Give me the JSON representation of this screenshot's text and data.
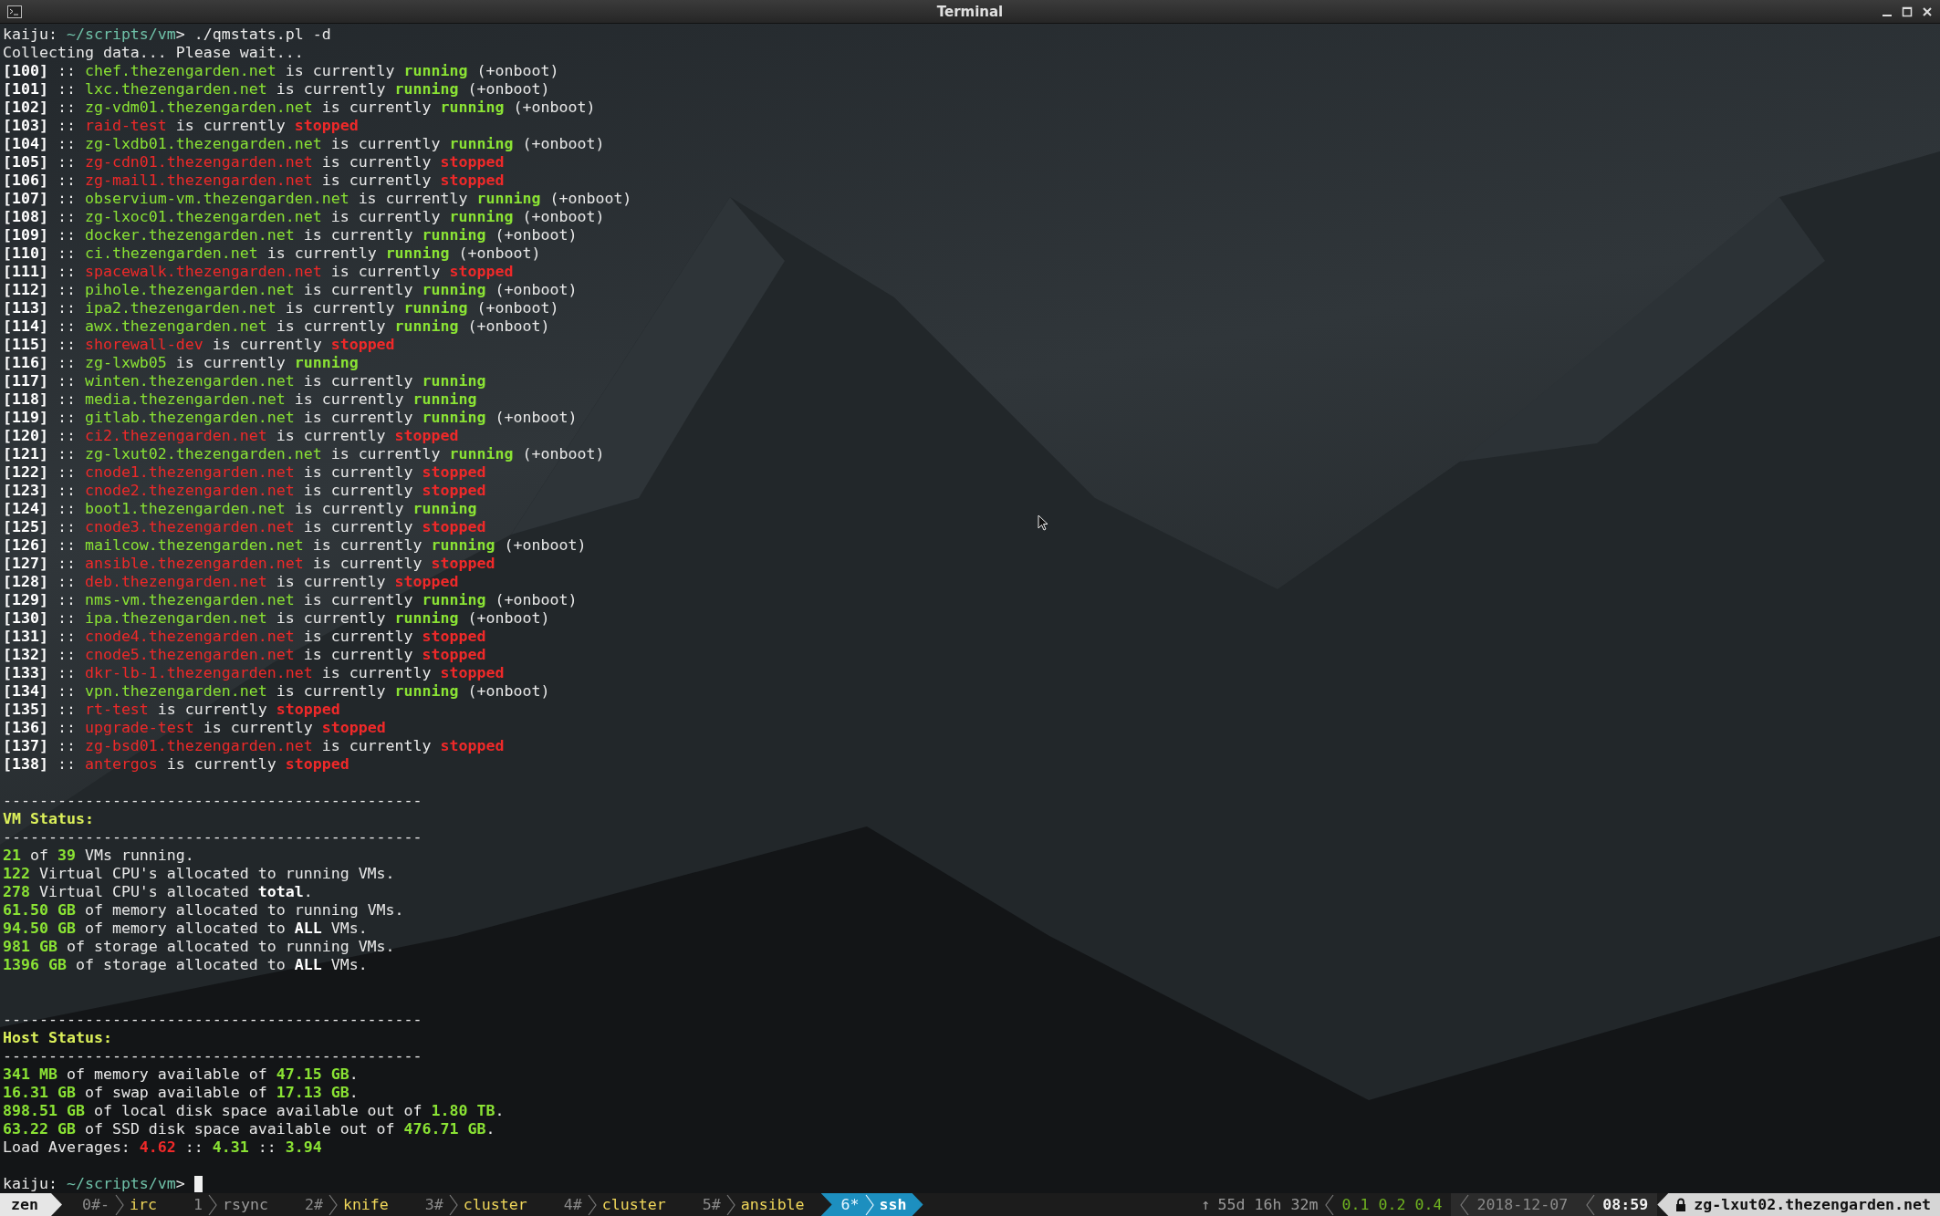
{
  "title_bar": {
    "title": "Terminal"
  },
  "terminal": {
    "command": {
      "user": "kaiju:",
      "path": "~/scripts/vm",
      "symbol": ">",
      "command": "./qmstats.pl -d"
    },
    "message": "Collecting data... Please wait...",
    "vms": [
      {
        "id": "[100]",
        "sep": "::",
        "host": "chef.thezengarden.net",
        "verb": "is currently",
        "state": "running",
        "kind": "running",
        "onboot": "(+onboot)"
      },
      {
        "id": "[101]",
        "sep": "::",
        "host": "lxc.thezengarden.net",
        "verb": "is currently",
        "state": "running",
        "kind": "running",
        "onboot": "(+onboot)"
      },
      {
        "id": "[102]",
        "sep": "::",
        "host": "zg-vdm01.thezengarden.net",
        "verb": "is currently",
        "state": "running",
        "kind": "running",
        "onboot": "(+onboot)"
      },
      {
        "id": "[103]",
        "sep": "::",
        "host": "raid-test",
        "verb": "is currently",
        "state": "stopped",
        "kind": "stopped"
      },
      {
        "id": "[104]",
        "sep": "::",
        "host": "zg-lxdb01.thezengarden.net",
        "verb": "is currently",
        "state": "running",
        "kind": "running",
        "onboot": "(+onboot)"
      },
      {
        "id": "[105]",
        "sep": "::",
        "host": "zg-cdn01.thezengarden.net",
        "verb": "is currently",
        "state": "stopped",
        "kind": "stopped"
      },
      {
        "id": "[106]",
        "sep": "::",
        "host": "zg-mail1.thezengarden.net",
        "verb": "is currently",
        "state": "stopped",
        "kind": "stopped"
      },
      {
        "id": "[107]",
        "sep": "::",
        "host": "observium-vm.thezengarden.net",
        "verb": "is currently",
        "state": "running",
        "kind": "running",
        "onboot": "(+onboot)"
      },
      {
        "id": "[108]",
        "sep": "::",
        "host": "zg-lxoc01.thezengarden.net",
        "verb": "is currently",
        "state": "running",
        "kind": "running",
        "onboot": "(+onboot)"
      },
      {
        "id": "[109]",
        "sep": "::",
        "host": "docker.thezengarden.net",
        "verb": "is currently",
        "state": "running",
        "kind": "running",
        "onboot": "(+onboot)"
      },
      {
        "id": "[110]",
        "sep": "::",
        "host": "ci.thezengarden.net",
        "verb": "is currently",
        "state": "running",
        "kind": "running",
        "onboot": "(+onboot)"
      },
      {
        "id": "[111]",
        "sep": "::",
        "host": "spacewalk.thezengarden.net",
        "verb": "is currently",
        "state": "stopped",
        "kind": "stopped"
      },
      {
        "id": "[112]",
        "sep": "::",
        "host": "pihole.thezengarden.net",
        "verb": "is currently",
        "state": "running",
        "kind": "running",
        "onboot": "(+onboot)"
      },
      {
        "id": "[113]",
        "sep": "::",
        "host": "ipa2.thezengarden.net",
        "verb": "is currently",
        "state": "running",
        "kind": "running",
        "onboot": "(+onboot)"
      },
      {
        "id": "[114]",
        "sep": "::",
        "host": "awx.thezengarden.net",
        "verb": "is currently",
        "state": "running",
        "kind": "running",
        "onboot": "(+onboot)"
      },
      {
        "id": "[115]",
        "sep": "::",
        "host": "shorewall-dev",
        "verb": "is currently",
        "state": "stopped",
        "kind": "stopped"
      },
      {
        "id": "[116]",
        "sep": "::",
        "host": "zg-lxwb05",
        "verb": "is currently",
        "state": "running",
        "kind": "running"
      },
      {
        "id": "[117]",
        "sep": "::",
        "host": "winten.thezengarden.net",
        "verb": "is currently",
        "state": "running",
        "kind": "running"
      },
      {
        "id": "[118]",
        "sep": "::",
        "host": "media.thezengarden.net",
        "verb": "is currently",
        "state": "running",
        "kind": "running"
      },
      {
        "id": "[119]",
        "sep": "::",
        "host": "gitlab.thezengarden.net",
        "verb": "is currently",
        "state": "running",
        "kind": "running",
        "onboot": "(+onboot)"
      },
      {
        "id": "[120]",
        "sep": "::",
        "host": "ci2.thezengarden.net",
        "verb": "is currently",
        "state": "stopped",
        "kind": "stopped"
      },
      {
        "id": "[121]",
        "sep": "::",
        "host": "zg-lxut02.thezengarden.net",
        "verb": "is currently",
        "state": "running",
        "kind": "running",
        "onboot": "(+onboot)"
      },
      {
        "id": "[122]",
        "sep": "::",
        "host": "cnode1.thezengarden.net",
        "verb": "is currently",
        "state": "stopped",
        "kind": "stopped"
      },
      {
        "id": "[123]",
        "sep": "::",
        "host": "cnode2.thezengarden.net",
        "verb": "is currently",
        "state": "stopped",
        "kind": "stopped"
      },
      {
        "id": "[124]",
        "sep": "::",
        "host": "boot1.thezengarden.net",
        "verb": "is currently",
        "state": "running",
        "kind": "running"
      },
      {
        "id": "[125]",
        "sep": "::",
        "host": "cnode3.thezengarden.net",
        "verb": "is currently",
        "state": "stopped",
        "kind": "stopped"
      },
      {
        "id": "[126]",
        "sep": "::",
        "host": "mailcow.thezengarden.net",
        "verb": "is currently",
        "state": "running",
        "kind": "running",
        "onboot": "(+onboot)"
      },
      {
        "id": "[127]",
        "sep": "::",
        "host": "ansible.thezengarden.net",
        "verb": "is currently",
        "state": "stopped",
        "kind": "stopped"
      },
      {
        "id": "[128]",
        "sep": "::",
        "host": "deb.thezengarden.net",
        "verb": "is currently",
        "state": "stopped",
        "kind": "stopped"
      },
      {
        "id": "[129]",
        "sep": "::",
        "host": "nms-vm.thezengarden.net",
        "verb": "is currently",
        "state": "running",
        "kind": "running",
        "onboot": "(+onboot)"
      },
      {
        "id": "[130]",
        "sep": "::",
        "host": "ipa.thezengarden.net",
        "verb": "is currently",
        "state": "running",
        "kind": "running",
        "onboot": "(+onboot)"
      },
      {
        "id": "[131]",
        "sep": "::",
        "host": "cnode4.thezengarden.net",
        "verb": "is currently",
        "state": "stopped",
        "kind": "stopped"
      },
      {
        "id": "[132]",
        "sep": "::",
        "host": "cnode5.thezengarden.net",
        "verb": "is currently",
        "state": "stopped",
        "kind": "stopped"
      },
      {
        "id": "[133]",
        "sep": "::",
        "host": "dkr-lb-1.thezengarden.net",
        "verb": "is currently",
        "state": "stopped",
        "kind": "stopped"
      },
      {
        "id": "[134]",
        "sep": "::",
        "host": "vpn.thezengarden.net",
        "verb": "is currently",
        "state": "running",
        "kind": "running",
        "onboot": "(+onboot)"
      },
      {
        "id": "[135]",
        "sep": "::",
        "host": "rt-test",
        "verb": "is currently",
        "state": "stopped",
        "kind": "stopped"
      },
      {
        "id": "[136]",
        "sep": "::",
        "host": "upgrade-test",
        "verb": "is currently",
        "state": "stopped",
        "kind": "stopped"
      },
      {
        "id": "[137]",
        "sep": "::",
        "host": "zg-bsd01.thezengarden.net",
        "verb": "is currently",
        "state": "stopped",
        "kind": "stopped"
      },
      {
        "id": "[138]",
        "sep": "::",
        "host": "antergos",
        "verb": "is currently",
        "state": "stopped",
        "kind": "stopped"
      }
    ],
    "report": [
      {
        "kind": "blank"
      },
      {
        "kind": "rule",
        "segments": [
          {
            "text": "----------------------------------------------",
            "kind": "plain"
          }
        ]
      },
      {
        "kind": "heading",
        "segments": [
          {
            "text": "VM Status:",
            "kind": "heading"
          }
        ]
      },
      {
        "kind": "rule",
        "segments": [
          {
            "text": "----------------------------------------------",
            "kind": "plain"
          }
        ]
      },
      {
        "kind": "text",
        "segments": [
          {
            "text": "21",
            "kind": "number"
          },
          {
            "text": " of ",
            "kind": "plain"
          },
          {
            "text": "39",
            "kind": "number"
          },
          {
            "text": " VMs running.",
            "kind": "plain"
          }
        ]
      },
      {
        "kind": "text",
        "segments": [
          {
            "text": "122",
            "kind": "number"
          },
          {
            "text": " Virtual CPU's allocated to running VMs.",
            "kind": "plain"
          }
        ]
      },
      {
        "kind": "text",
        "segments": [
          {
            "text": "278",
            "kind": "number"
          },
          {
            "text": " Virtual CPU's allocated ",
            "kind": "plain"
          },
          {
            "text": "total",
            "kind": "emphasis"
          },
          {
            "text": ".",
            "kind": "plain"
          }
        ]
      },
      {
        "kind": "text",
        "segments": [
          {
            "text": "61.50 GB",
            "kind": "number"
          },
          {
            "text": " of memory allocated to running VMs.",
            "kind": "plain"
          }
        ]
      },
      {
        "kind": "text",
        "segments": [
          {
            "text": "94.50 GB",
            "kind": "number"
          },
          {
            "text": " of memory allocated to ",
            "kind": "plain"
          },
          {
            "text": "ALL",
            "kind": "emphasis"
          },
          {
            "text": " VMs.",
            "kind": "plain"
          }
        ]
      },
      {
        "kind": "text",
        "segments": [
          {
            "text": "981 GB",
            "kind": "number"
          },
          {
            "text": " of storage allocated to running VMs.",
            "kind": "plain"
          }
        ]
      },
      {
        "kind": "text",
        "segments": [
          {
            "text": "1396 GB",
            "kind": "number"
          },
          {
            "text": " of storage allocated to ",
            "kind": "plain"
          },
          {
            "text": "ALL",
            "kind": "emphasis"
          },
          {
            "text": " VMs.",
            "kind": "plain"
          }
        ]
      },
      {
        "kind": "blank"
      },
      {
        "kind": "blank"
      },
      {
        "kind": "rule",
        "segments": [
          {
            "text": "----------------------------------------------",
            "kind": "plain"
          }
        ]
      },
      {
        "kind": "heading",
        "segments": [
          {
            "text": "Host Status:",
            "kind": "heading"
          }
        ]
      },
      {
        "kind": "rule",
        "segments": [
          {
            "text": "----------------------------------------------",
            "kind": "plain"
          }
        ]
      },
      {
        "kind": "text",
        "segments": [
          {
            "text": "341 MB",
            "kind": "number"
          },
          {
            "text": " of memory available of ",
            "kind": "plain"
          },
          {
            "text": "47.15 GB",
            "kind": "number"
          },
          {
            "text": ".",
            "kind": "plain"
          }
        ]
      },
      {
        "kind": "text",
        "segments": [
          {
            "text": "16.31 GB",
            "kind": "number"
          },
          {
            "text": " of swap available of ",
            "kind": "plain"
          },
          {
            "text": "17.13 GB",
            "kind": "number"
          },
          {
            "text": ".",
            "kind": "plain"
          }
        ]
      },
      {
        "kind": "text",
        "segments": [
          {
            "text": "898.51 GB",
            "kind": "number"
          },
          {
            "text": " of local disk space available out of ",
            "kind": "plain"
          },
          {
            "text": "1.80 TB",
            "kind": "number"
          },
          {
            "text": ".",
            "kind": "plain"
          }
        ]
      },
      {
        "kind": "text",
        "segments": [
          {
            "text": "63.22 GB",
            "kind": "number"
          },
          {
            "text": " of SSD disk space available out of ",
            "kind": "plain"
          },
          {
            "text": "476.71 GB",
            "kind": "number"
          },
          {
            "text": ".",
            "kind": "plain"
          }
        ]
      },
      {
        "kind": "text",
        "segments": [
          {
            "text": "Load Averages: ",
            "kind": "plain"
          },
          {
            "text": "4.62",
            "kind": "alert"
          },
          {
            "text": " :: ",
            "kind": "plain"
          },
          {
            "text": "4.31",
            "kind": "number"
          },
          {
            "text": " :: ",
            "kind": "plain"
          },
          {
            "text": "3.94",
            "kind": "number"
          }
        ]
      },
      {
        "kind": "blank"
      }
    ],
    "prompt": {
      "user": "kaiju:",
      "path": "~/scripts/vm",
      "symbol": ">",
      "cursor": true
    }
  },
  "status_bar": {
    "session": "zen",
    "windows": [
      {
        "index": "0#-",
        "name": "irc",
        "selected": false,
        "activity": true
      },
      {
        "index": "1",
        "name": "rsync",
        "selected": false,
        "activity": false
      },
      {
        "index": "2#",
        "name": "knife",
        "selected": false,
        "activity": true
      },
      {
        "index": "3#",
        "name": "cluster",
        "selected": false,
        "activity": true
      },
      {
        "index": "4#",
        "name": "cluster",
        "selected": false,
        "activity": true
      },
      {
        "index": "5#",
        "name": "ansible",
        "selected": false,
        "activity": true
      },
      {
        "index": "6*",
        "name": "ssh",
        "selected": true,
        "activity": false
      }
    ],
    "uptime_arrow": "↑",
    "uptime": "55d 16h 32m",
    "load": "0.1 0.2 0.4",
    "date": "2018-12-07",
    "time": "08:59",
    "host": "zg-lxut02.thezengarden.net"
  }
}
